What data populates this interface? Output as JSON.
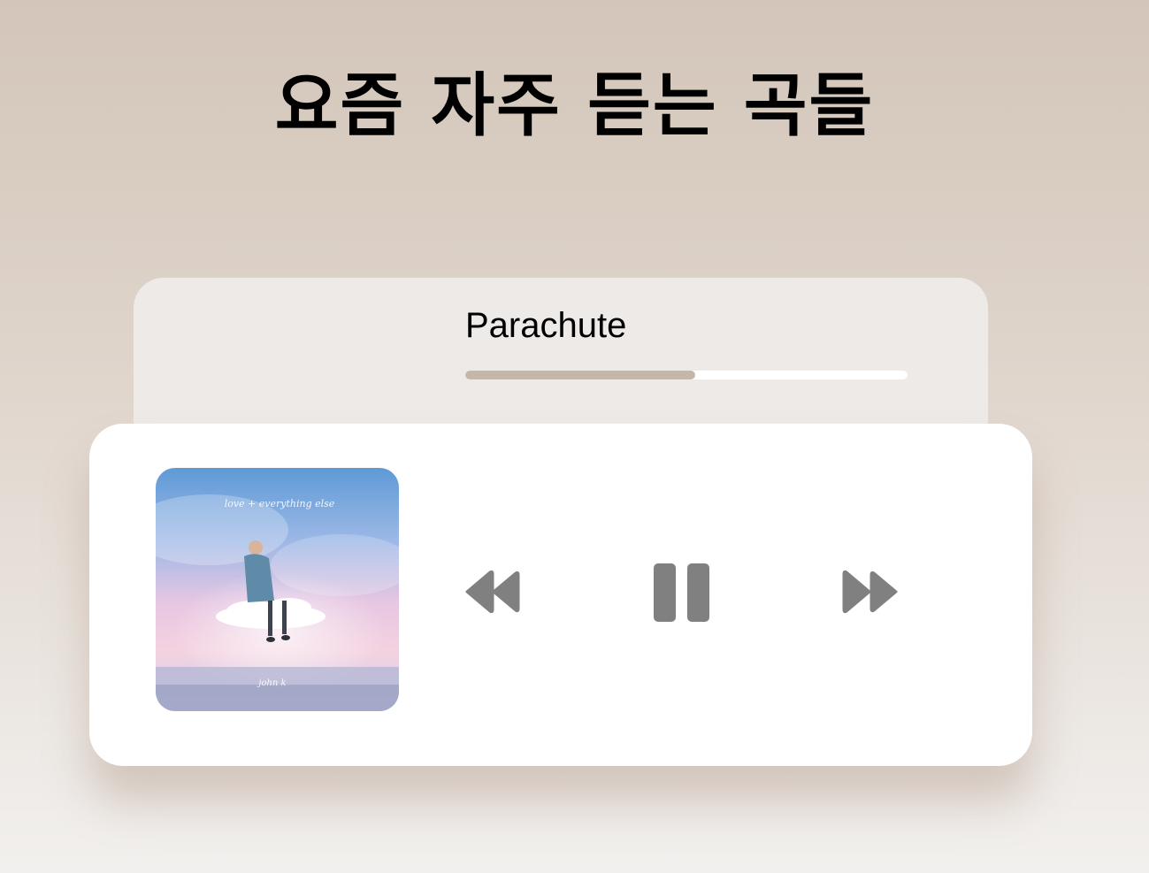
{
  "header": {
    "title": "요즘 자주 듣는 곡들"
  },
  "now_playing": {
    "song_title": "Parachute",
    "progress": 0.52,
    "album": {
      "cover_text": "love + everything else",
      "artist_signature": "john k"
    }
  },
  "controls": {
    "rewind_icon": "rewind-icon",
    "pause_icon": "pause-icon",
    "forward_icon": "fast-forward-icon",
    "icon_color": "#808080"
  },
  "colors": {
    "progress_fill": "#c5b6aa",
    "progress_track": "#ffffff",
    "info_card": "#eeeae7",
    "player_card": "#ffffff"
  }
}
